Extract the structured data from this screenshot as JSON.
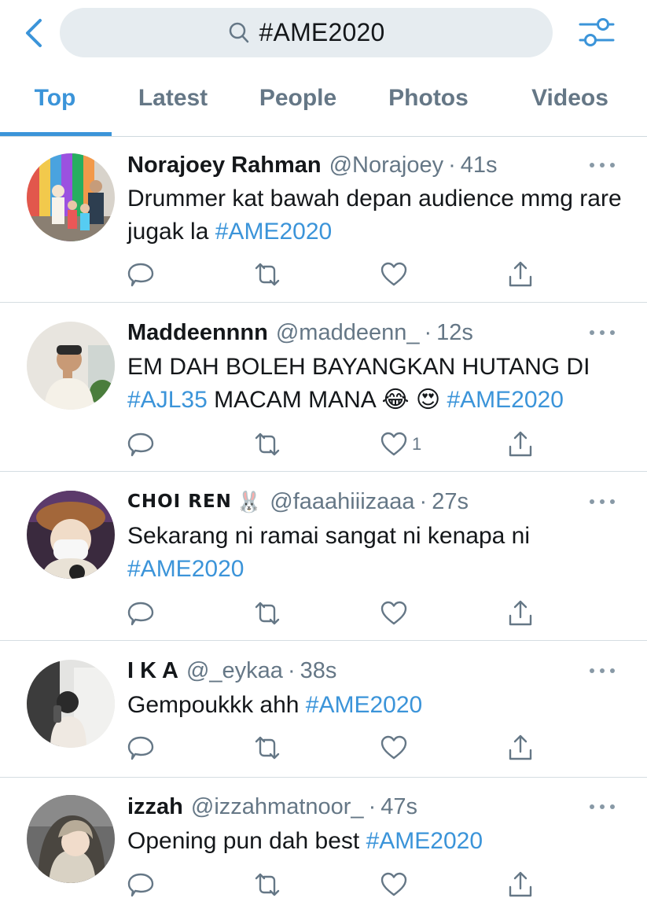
{
  "search": {
    "query": "#AME2020"
  },
  "tabs": [
    {
      "label": "Top",
      "active": true
    },
    {
      "label": "Latest",
      "active": false
    },
    {
      "label": "People",
      "active": false
    },
    {
      "label": "Photos",
      "active": false
    },
    {
      "label": "Videos",
      "active": false
    }
  ],
  "colors": {
    "accent": "#3b94d9",
    "secondary_text": "#657786",
    "search_bg": "#e6ecf0"
  },
  "tweets": [
    {
      "name": "Norajoey Rahman",
      "handle": "@Norajoey",
      "time": "41s",
      "text_parts": [
        "Drummer kat bawah depan audience mmg rare jugak la "
      ],
      "hashtags": [
        "#AME2020"
      ],
      "likes": ""
    },
    {
      "name": "Maddeennnn",
      "handle": "@maddeenn_",
      "time": "12s",
      "line1": "EM DAH BOLEH BAYANGKAN HUTANG DI",
      "hashtag_a": "#AJL35",
      "mid": " MACAM MANA ",
      "emoji_a": "😂",
      "emoji_b": "😍",
      "hashtag_b": "#AME2020",
      "likes": "1"
    },
    {
      "name": "CHOI REN",
      "name_emoji": "🐰",
      "handle": "@faaahiiizaaa",
      "time": "27s",
      "text": "Sekarang ni ramai sangat ni kenapa ni",
      "hashtag": "#AME2020",
      "likes": ""
    },
    {
      "name": "I K A",
      "handle": "@_eykaa",
      "time": "38s",
      "text": "Gempoukkk ahh ",
      "hashtag": "#AME2020",
      "likes": ""
    },
    {
      "name": "izzah",
      "handle": "@izzahmatnoor_",
      "time": "47s",
      "text": "Opening pun dah best ",
      "hashtag": "#AME2020",
      "likes": ""
    }
  ],
  "separator": "·",
  "icons": [
    "back-chevron-icon",
    "search-icon",
    "filter-sliders-icon",
    "more-icon",
    "reply-icon",
    "retweet-icon",
    "like-icon",
    "share-icon"
  ]
}
